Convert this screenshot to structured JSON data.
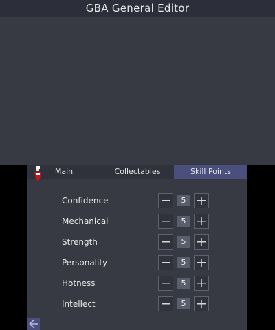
{
  "app": {
    "title": "GBA General Editor"
  },
  "tabs": [
    {
      "label": "Main"
    },
    {
      "label": "Collectables"
    },
    {
      "label": "Skill Points",
      "active": true
    }
  ],
  "skills": [
    {
      "label": "Confidence",
      "value": "5"
    },
    {
      "label": "Mechanical",
      "value": "5"
    },
    {
      "label": "Strength",
      "value": "5"
    },
    {
      "label": "Personality",
      "value": "5"
    },
    {
      "label": "Hotness",
      "value": "5"
    },
    {
      "label": "Intellect",
      "value": "5"
    }
  ],
  "icons": {
    "app": "potion-icon",
    "back": "back-arrow-icon",
    "decrement": "minus-icon",
    "increment": "plus-icon"
  },
  "colors": {
    "accent": "#4a4f7d",
    "background": "#373a42",
    "title_bar": "#2c2f3a"
  }
}
